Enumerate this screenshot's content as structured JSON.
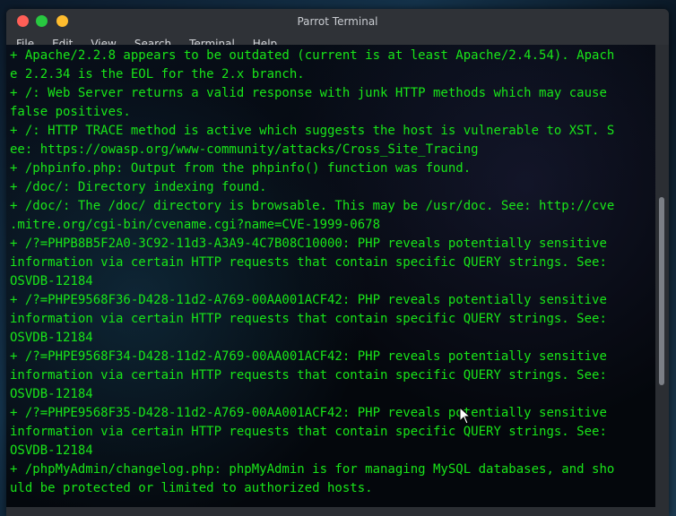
{
  "window": {
    "title": "Parrot Terminal"
  },
  "menu": [
    "File",
    "Edit",
    "View",
    "Search",
    "Terminal",
    "Help"
  ],
  "terminal": {
    "lines": [
      "+ Apache/2.2.8 appears to be outdated (current is at least Apache/2.4.54). Apach",
      "e 2.2.34 is the EOL for the 2.x branch.",
      "+ /: Web Server returns a valid response with junk HTTP methods which may cause",
      "false positives.",
      "+ /: HTTP TRACE method is active which suggests the host is vulnerable to XST. S",
      "ee: https://owasp.org/www-community/attacks/Cross_Site_Tracing",
      "+ /phpinfo.php: Output from the phpinfo() function was found.",
      "+ /doc/: Directory indexing found.",
      "+ /doc/: The /doc/ directory is browsable. This may be /usr/doc. See: http://cve",
      ".mitre.org/cgi-bin/cvename.cgi?name=CVE-1999-0678",
      "+ /?=PHPB8B5F2A0-3C92-11d3-A3A9-4C7B08C10000: PHP reveals potentially sensitive",
      "information via certain HTTP requests that contain specific QUERY strings. See:",
      "OSVDB-12184",
      "+ /?=PHPE9568F36-D428-11d2-A769-00AA001ACF42: PHP reveals potentially sensitive",
      "information via certain HTTP requests that contain specific QUERY strings. See:",
      "OSVDB-12184",
      "+ /?=PHPE9568F34-D428-11d2-A769-00AA001ACF42: PHP reveals potentially sensitive",
      "information via certain HTTP requests that contain specific QUERY strings. See:",
      "OSVDB-12184",
      "+ /?=PHPE9568F35-D428-11d2-A769-00AA001ACF42: PHP reveals potentially sensitive",
      "information via certain HTTP requests that contain specific QUERY strings. See:",
      "OSVDB-12184",
      "+ /phpMyAdmin/changelog.php: phpMyAdmin is for managing MySQL databases, and sho",
      "uld be protected or limited to authorized hosts."
    ]
  },
  "colors": {
    "terminal_text": "#19e619",
    "terminal_bg": "#04070c",
    "close": "#ff5f57",
    "maximize": "#28c840",
    "minimize": "#febc2e"
  },
  "icons": {
    "close": "close-icon",
    "maximize": "maximize-icon",
    "minimize": "minimize-icon",
    "cursor": "mouse-pointer-icon"
  }
}
